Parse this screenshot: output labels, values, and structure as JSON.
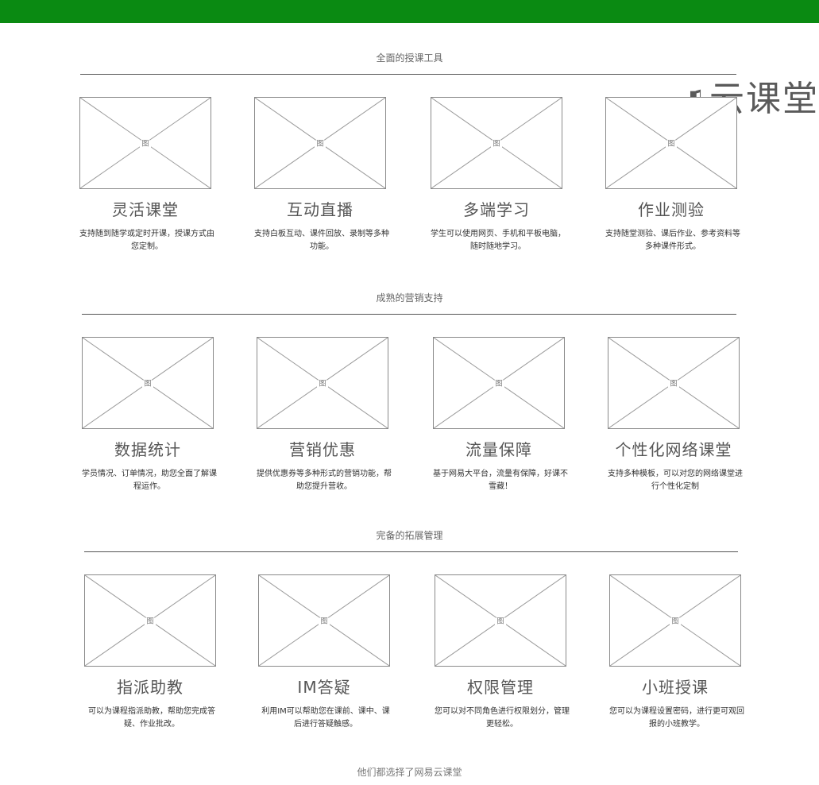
{
  "logo": {
    "text": "云课堂"
  },
  "placeholder_label": "图",
  "sections": [
    {
      "title": "全面的授课工具",
      "items": [
        {
          "title": "灵活课堂",
          "desc": "支持随到随学或定时开课，授课方式由您定制。"
        },
        {
          "title": "互动直播",
          "desc": "支持白板互动、课件回放、录制等多种功能。"
        },
        {
          "title": "多端学习",
          "desc": "学生可以使用网页、手机和平板电脑，随时随地学习。"
        },
        {
          "title": "作业测验",
          "desc": "支持随堂测验、课后作业、参考资料等多种课件形式。"
        }
      ]
    },
    {
      "title": "成熟的营销支持",
      "items": [
        {
          "title": "数据统计",
          "desc": "学员情况、订单情况，助您全面了解课程运作。"
        },
        {
          "title": "营销优惠",
          "desc": "提供优惠券等多种形式的营销功能，帮助您提升营收。"
        },
        {
          "title": "流量保障",
          "desc": "基于网易大平台，流量有保障，好课不雪藏！"
        },
        {
          "title": "个性化网络课堂",
          "desc": "支持多种模板，可以对您的网络课堂进行个性化定制"
        }
      ]
    },
    {
      "title": "完备的拓展管理",
      "items": [
        {
          "title": "指派助教",
          "desc": "可以为课程指派助教，帮助您完成答疑、作业批改。"
        },
        {
          "title": "IM答疑",
          "desc": "利用IM可以帮助您在课前、课中、课后进行答疑触感。"
        },
        {
          "title": "权限管理",
          "desc": "您可以对不同角色进行权限划分，管理更轻松。"
        },
        {
          "title": "小班授课",
          "desc": "您可以为课程设置密码，进行更可观回报的小班教学。"
        }
      ]
    }
  ],
  "footer": {
    "text": "他们都选择了网易云课堂"
  },
  "colors": {
    "top_bar": "#0a8a12"
  }
}
